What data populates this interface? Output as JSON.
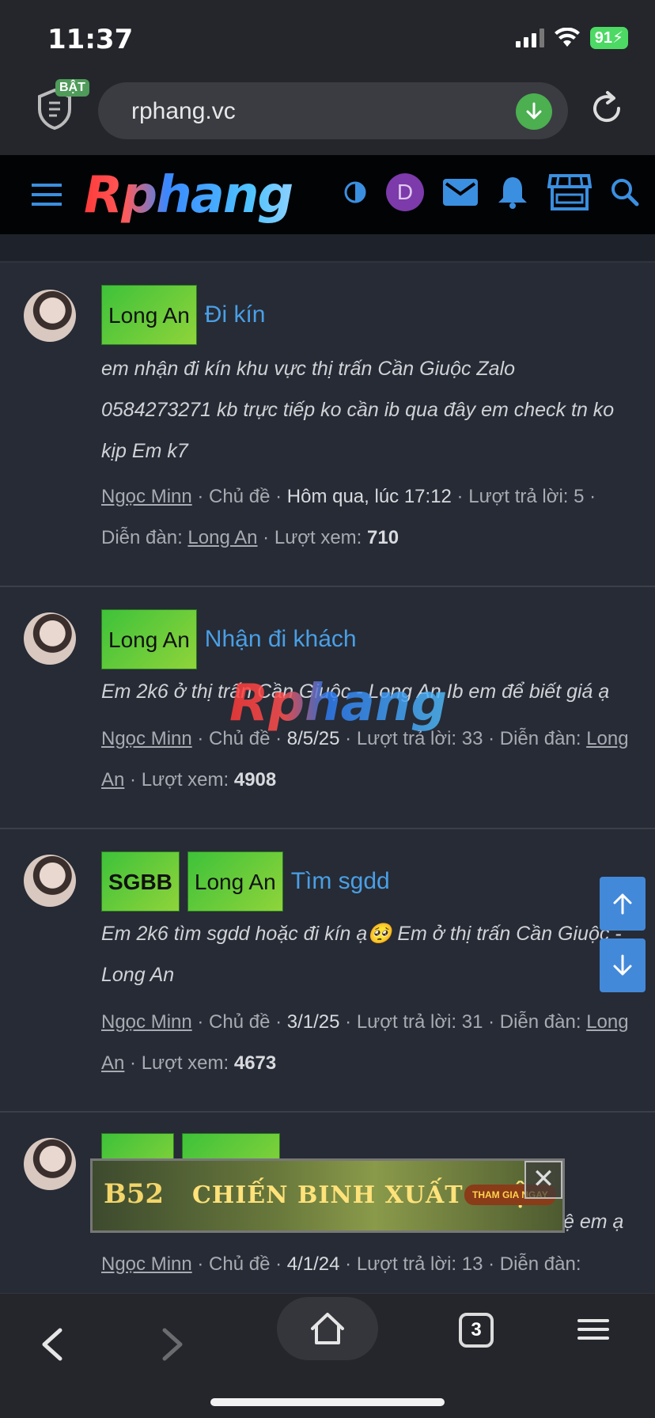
{
  "status": {
    "time": "11:37",
    "battery": "91"
  },
  "browser": {
    "shield_badge": "BẬT",
    "url": "rphang.vc",
    "tabs_count": "3"
  },
  "site": {
    "logo": "Rphang",
    "user_initial": "D",
    "watermark": "Rphang"
  },
  "threads": [
    {
      "tags": [
        "Long An"
      ],
      "title": "Đi kín",
      "excerpt": "em nhận đi kín khu vực thị trấn Cần Giuộc Zalo 0584273271 kb trực tiếp ko cần ib qua đây em check tn ko kịp Em k7",
      "author": "Ngọc Minn",
      "type": "Chủ đề",
      "date": "Hôm qua, lúc 17:12",
      "replies_label": "Lượt trả lời:",
      "replies": "5",
      "forum_label": "Diễn đàn:",
      "forum": "Long An",
      "views_label": "Lượt xem:",
      "views": "710"
    },
    {
      "tags": [
        "Long An"
      ],
      "title": "Nhận đi khách",
      "excerpt": "Em 2k6 ở thị trấn Cần Giuộc - Long An Ib em để biết giá ạ",
      "author": "Ngọc Minn",
      "type": "Chủ đề",
      "date": "8/5/25",
      "replies_label": "Lượt trả lời:",
      "replies": "33",
      "forum_label": "Diễn đàn:",
      "forum": "Long An",
      "views_label": "Lượt xem:",
      "views": "4908"
    },
    {
      "tags": [
        "SGBB",
        "Long An"
      ],
      "title": "Tìm sgdd",
      "excerpt": "Em 2k6 tìm sgdd hoặc đi kín ạ🥺  Em ở thị trấn Cần Giuộc - Long An",
      "author": "Ngọc Minn",
      "type": "Chủ đề",
      "date": "3/1/25",
      "replies_label": "Lượt trả lời:",
      "replies": "31",
      "forum_label": "Diễn đàn:",
      "forum": "Long An",
      "views_label": "Lượt xem:",
      "views": "4673"
    },
    {
      "excerpt_tail": "ệ em ạ",
      "author": "Ngọc Minn",
      "type": "Chủ đề",
      "date": "4/1/24",
      "replies_label": "Lượt trả lời:",
      "replies": "13",
      "forum_label": "Diễn đàn:"
    }
  ],
  "ad": {
    "logo": "B52",
    "headline": "CHIẾN BINH XUẤT TRẬN",
    "cta": "THAM GIA NGAY",
    "close": "✕"
  }
}
